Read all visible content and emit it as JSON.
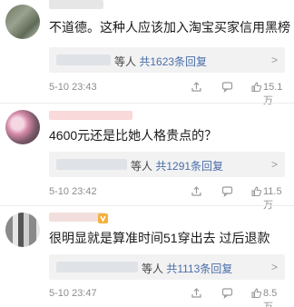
{
  "comments": [
    {
      "text": "不道德。这种人应该加入淘宝买家信用黑榜",
      "reply_suffix": "等人",
      "reply_total": "共1623条回复",
      "reply_chevron": ">",
      "time": "5-10 23:43",
      "likes": "15.1万"
    },
    {
      "text": "4600元还是比她人格贵点的？",
      "reply_suffix": "等人",
      "reply_total": "共1291条回复",
      "reply_chevron": ">",
      "time": "5-10 23:42",
      "likes": "11.5万"
    },
    {
      "text": "很明显就是算准时间51穿出去 过后退款",
      "reply_suffix": "等人",
      "reply_total": "共1113条回复",
      "reply_chevron": ">",
      "time": "5-10 23:47",
      "likes": "8.5万"
    }
  ],
  "icons": {
    "share": "share-icon",
    "reply": "comment-icon",
    "like": "thumbs-up-icon",
    "vip": "vip-badge-icon"
  },
  "colors": {
    "link": "#4a6ea9",
    "reply_bg": "#f2f2f2",
    "meta_text": "#8c8c8c"
  }
}
